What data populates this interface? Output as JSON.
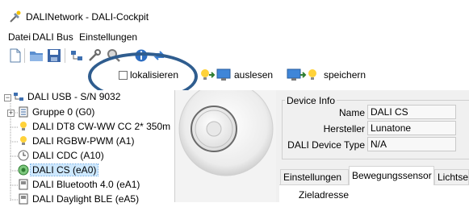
{
  "window": {
    "title": "DALINetwork - DALI-Cockpit"
  },
  "menu": [
    "Datei",
    "DALI Bus",
    "Einstellungen"
  ],
  "actions": {
    "locate_label": "lokalisieren",
    "locate_checked": false,
    "read_label": "auslesen",
    "save_label": "speichern"
  },
  "tree": {
    "root": "DALI USB - S/N 9032",
    "items": [
      {
        "label": "Gruppe 0 (G0)",
        "icon": "group-icon"
      },
      {
        "label": "DALI DT8 CW-WW CC 2* 350m",
        "icon": "bulb-icon"
      },
      {
        "label": "DALI RGBW-PWM (A1)",
        "icon": "bulb-icon"
      },
      {
        "label": "DALI CDC (A10)",
        "icon": "clock-icon"
      },
      {
        "label": "DALI CS (eA0)",
        "icon": "sensor-icon",
        "selected": true
      },
      {
        "label": "DALI Bluetooth 4.0 (eA1)",
        "icon": "device-icon"
      },
      {
        "label": "DALI Daylight BLE (eA5)",
        "icon": "device-icon"
      }
    ]
  },
  "device_info": {
    "legend": "Device Info",
    "name_label": "Name",
    "name_value": "DALI CS",
    "manufacturer_label": "Hersteller",
    "manufacturer_value": "Lunatone",
    "type_label": "DALI Device Type",
    "type_value": "N/A"
  },
  "tabs": [
    "Einstellungen",
    "Bewegungssensor",
    "Lichtse"
  ],
  "active_tab": 1,
  "target": {
    "legend": "Zieladresse"
  },
  "colors": {
    "highlight_ring": "#2f5d8f",
    "selection": "#cde8ff"
  }
}
